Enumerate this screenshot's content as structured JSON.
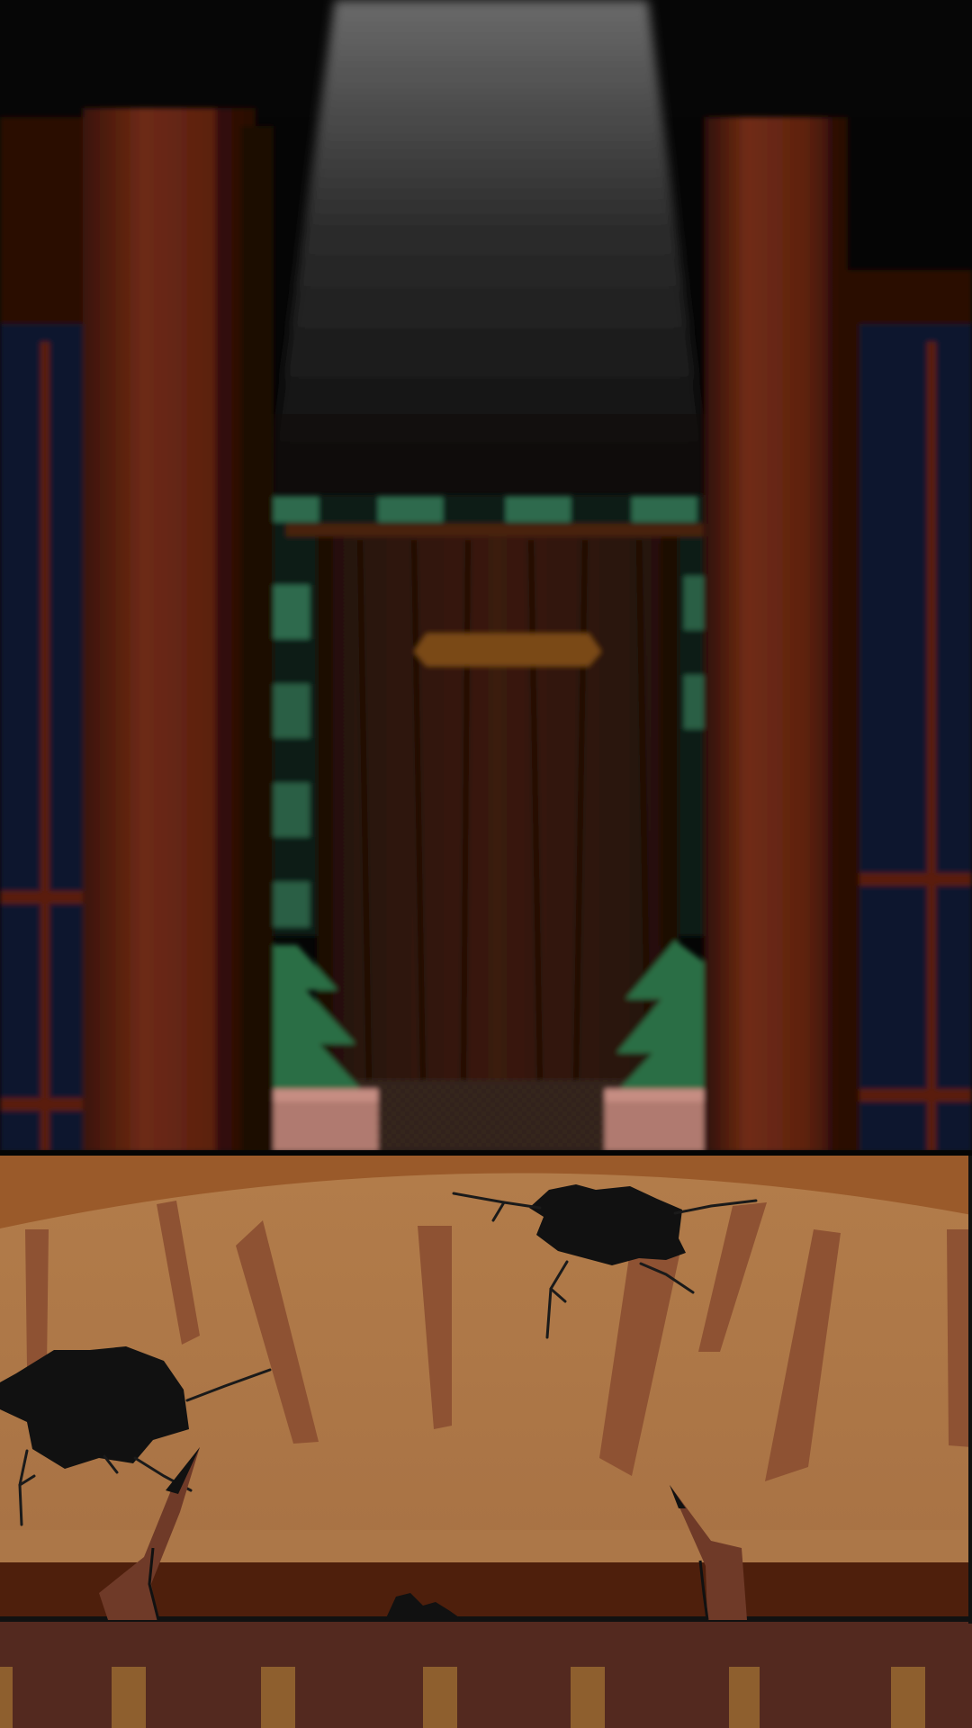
{
  "scene": {
    "name": "haunted-hallway",
    "colors": {
      "ceiling_light": "#5a5a5a",
      "pillar_red": "#6b2612",
      "pillar_dark": "#3a1208",
      "curtain": "#33170b",
      "curtain_valance": "#7a4a14",
      "wallpaper_green": "#2f6b4d",
      "plant_green": "#2a6e45",
      "planter_pink": "#b07a70",
      "window_blue": "#101c48",
      "floor_tile": "#2a1f17"
    },
    "icons": [
      "spotlight-beam",
      "left-pillar",
      "right-pillar",
      "curtain",
      "potted-tree-left",
      "potted-tree-right",
      "window-left",
      "window-right"
    ]
  },
  "foreground": {
    "name": "cracked-wooden-counter",
    "colors": {
      "counter_top": "#ab7648",
      "counter_top_light": "#b88352",
      "counter_back": "#9a5a2a",
      "streak": "#8e5233",
      "counter_edge": "#4e1f0c",
      "base": "#53291f",
      "base_slat": "#8e5f2e",
      "hole": "#111111",
      "crack": "#1a1a1a",
      "splinter": "#6f3a28"
    },
    "holes": 3,
    "splinters": 2
  }
}
